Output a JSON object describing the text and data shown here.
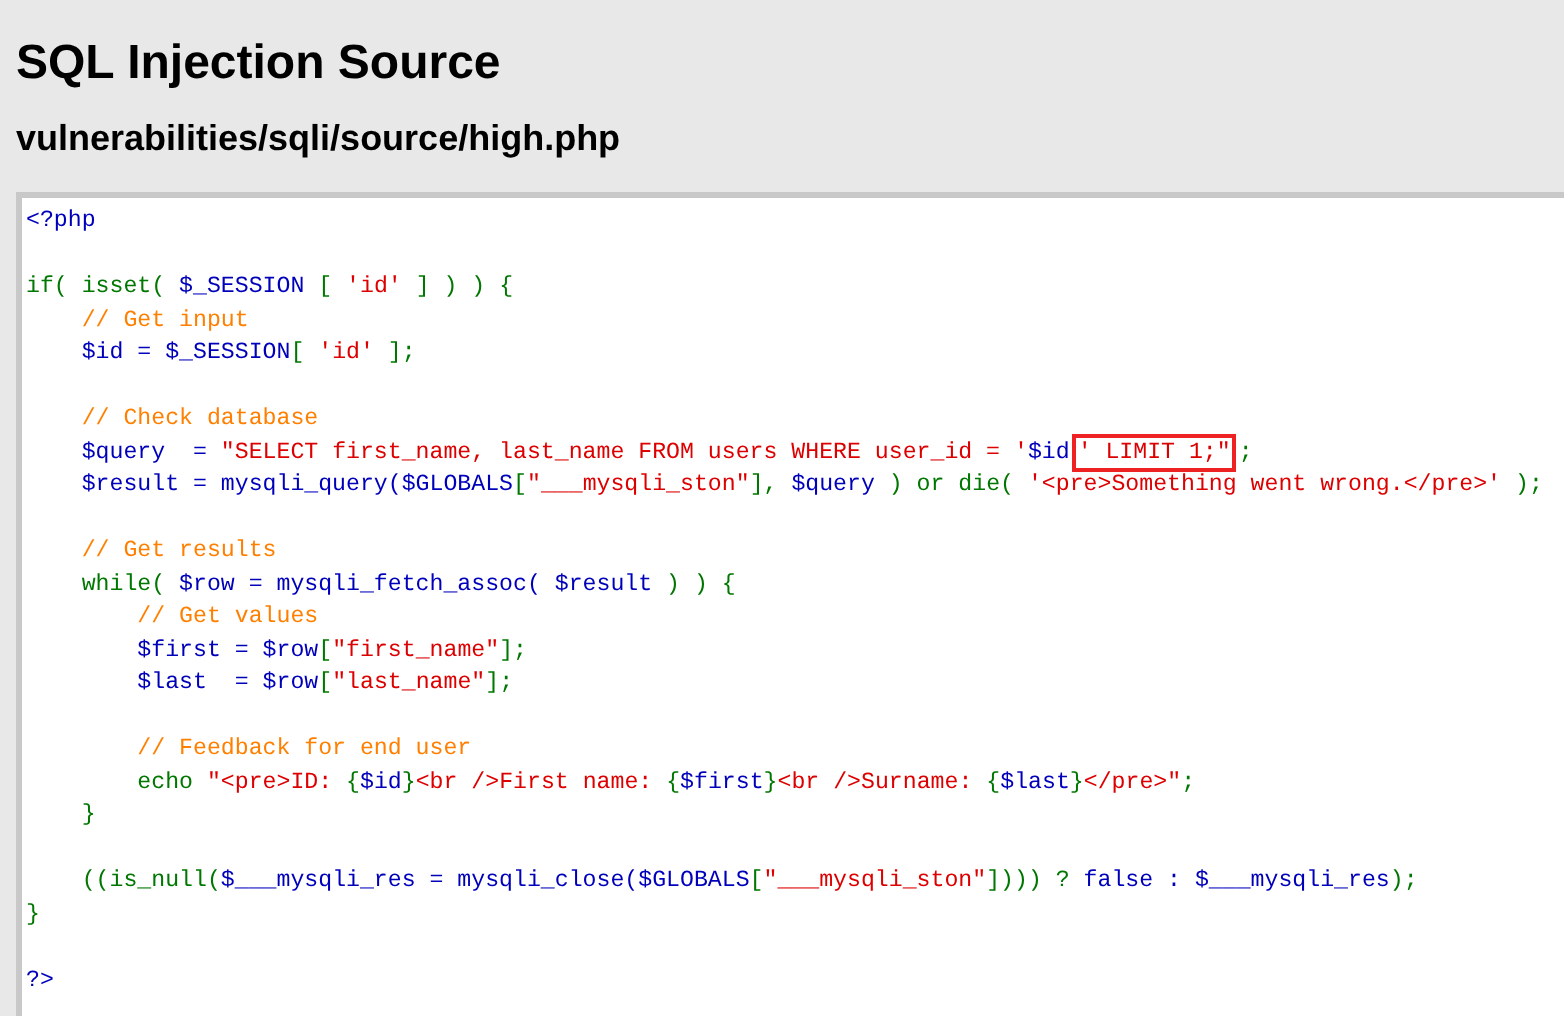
{
  "page": {
    "title": "SQL Injection Source",
    "file_path": "vulnerabilities/sqli/source/high.php"
  },
  "code_lines": [
    {
      "tokens": [
        {
          "kind": "variable",
          "text": "<?php"
        }
      ]
    },
    {
      "blank_before": true,
      "tokens": [
        {
          "kind": "keyword",
          "text": "if( isset( "
        },
        {
          "kind": "variable",
          "text": "$_SESSION"
        },
        {
          "kind": "keyword",
          "text": " [ "
        },
        {
          "kind": "string",
          "text": "'id'"
        },
        {
          "kind": "keyword",
          "text": " ] ) ) {"
        }
      ]
    },
    {
      "tokens": [
        {
          "kind": "comment",
          "text": "    // Get input"
        }
      ]
    },
    {
      "tokens": [
        {
          "kind": "variable",
          "text": "    $id = $_SESSION"
        },
        {
          "kind": "keyword",
          "text": "[ "
        },
        {
          "kind": "string",
          "text": "'id'"
        },
        {
          "kind": "keyword",
          "text": " ];"
        }
      ]
    },
    {
      "blank_before": true,
      "tokens": [
        {
          "kind": "comment",
          "text": "    // Check database"
        }
      ]
    },
    {
      "tokens": [
        {
          "kind": "variable",
          "text": "    $query  = "
        },
        {
          "kind": "string",
          "text": "\"SELECT first_name, last_name FROM users WHERE user_id = '"
        },
        {
          "kind": "variable",
          "text": "$id"
        },
        {
          "kind": "string",
          "text": "' LIMIT 1;\"",
          "highlighted": true
        },
        {
          "kind": "keyword",
          "text": ";"
        }
      ]
    },
    {
      "tokens": [
        {
          "kind": "variable",
          "text": "    $result = mysqli_query($GLOBALS"
        },
        {
          "kind": "keyword",
          "text": "["
        },
        {
          "kind": "string",
          "text": "\"___mysqli_ston\""
        },
        {
          "kind": "keyword",
          "text": "], "
        },
        {
          "kind": "variable",
          "text": "$query "
        },
        {
          "kind": "keyword",
          "text": ") or die( "
        },
        {
          "kind": "string",
          "text": "'<pre>Something went wrong.</pre>'"
        },
        {
          "kind": "keyword",
          "text": " );"
        }
      ]
    },
    {
      "blank_before": true,
      "tokens": [
        {
          "kind": "comment",
          "text": "    // Get results"
        }
      ]
    },
    {
      "tokens": [
        {
          "kind": "keyword",
          "text": "    while( "
        },
        {
          "kind": "variable",
          "text": "$row = mysqli_fetch_assoc( $result "
        },
        {
          "kind": "keyword",
          "text": ") ) {"
        }
      ]
    },
    {
      "tokens": [
        {
          "kind": "comment",
          "text": "        // Get values"
        }
      ]
    },
    {
      "tokens": [
        {
          "kind": "variable",
          "text": "        $first = $row"
        },
        {
          "kind": "keyword",
          "text": "["
        },
        {
          "kind": "string",
          "text": "\"first_name\""
        },
        {
          "kind": "keyword",
          "text": "];"
        }
      ]
    },
    {
      "tokens": [
        {
          "kind": "variable",
          "text": "        $last  = $row"
        },
        {
          "kind": "keyword",
          "text": "["
        },
        {
          "kind": "string",
          "text": "\"last_name\""
        },
        {
          "kind": "keyword",
          "text": "];"
        }
      ]
    },
    {
      "blank_before": true,
      "tokens": [
        {
          "kind": "comment",
          "text": "        // Feedback for end user"
        }
      ]
    },
    {
      "tokens": [
        {
          "kind": "keyword",
          "text": "        echo "
        },
        {
          "kind": "string",
          "text": "\"<pre>ID: "
        },
        {
          "kind": "keyword",
          "text": "{"
        },
        {
          "kind": "variable",
          "text": "$id"
        },
        {
          "kind": "keyword",
          "text": "}"
        },
        {
          "kind": "string",
          "text": "<br />First name: "
        },
        {
          "kind": "keyword",
          "text": "{"
        },
        {
          "kind": "variable",
          "text": "$first"
        },
        {
          "kind": "keyword",
          "text": "}"
        },
        {
          "kind": "string",
          "text": "<br />Surname: "
        },
        {
          "kind": "keyword",
          "text": "{"
        },
        {
          "kind": "variable",
          "text": "$last"
        },
        {
          "kind": "keyword",
          "text": "}"
        },
        {
          "kind": "string",
          "text": "</pre>\""
        },
        {
          "kind": "keyword",
          "text": ";"
        }
      ]
    },
    {
      "tokens": [
        {
          "kind": "keyword",
          "text": "    }"
        }
      ]
    },
    {
      "blank_before": true,
      "tokens": [
        {
          "kind": "keyword",
          "text": "    ((is_null("
        },
        {
          "kind": "variable",
          "text": "$___mysqli_res = mysqli_close($GLOBALS"
        },
        {
          "kind": "keyword",
          "text": "["
        },
        {
          "kind": "string",
          "text": "\"___mysqli_ston\""
        },
        {
          "kind": "keyword",
          "text": "]))) ? "
        },
        {
          "kind": "variable",
          "text": "false : $___mysqli_res"
        },
        {
          "kind": "keyword",
          "text": ");"
        }
      ]
    },
    {
      "tokens": [
        {
          "kind": "keyword",
          "text": "}"
        }
      ]
    },
    {
      "blank_before": true,
      "tokens": [
        {
          "kind": "variable",
          "text": "?>"
        }
      ]
    }
  ]
}
